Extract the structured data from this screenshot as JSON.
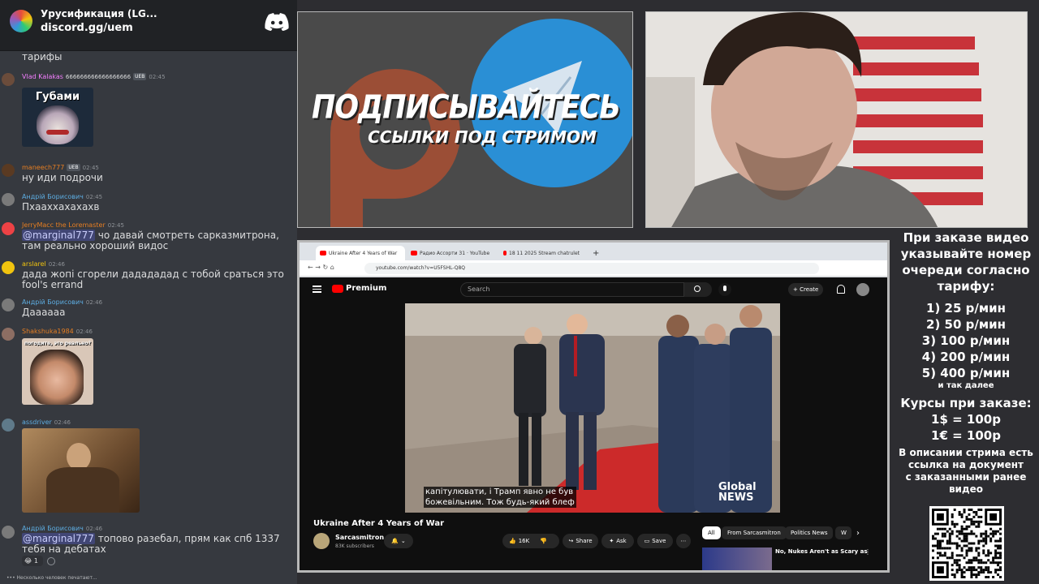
{
  "discord": {
    "server_name": "Урусификация (LG...",
    "invite": "discord.gg/uem",
    "typing": "Несколько человек печатают...",
    "top_partial_text": "тарифы",
    "messages": [
      {
        "user": "Vlad Kalakas",
        "text_inline": "666666666666666666",
        "badge": "UEB",
        "time": "02:45",
        "image_caption": "Губами"
      },
      {
        "user": "maneech777",
        "badge": "UEB",
        "time": "02:45",
        "text": "ну иди подрочи"
      },
      {
        "user": "Андрій Борисович",
        "time": "02:45",
        "text": "Пхааххахахахв"
      },
      {
        "user": "JerryMacc the Loremaster",
        "time": "02:45",
        "mention": "@marginal777",
        "text": "чо давай смотреть сарказмитрона, там реально хороший видос"
      },
      {
        "user": "arslarel",
        "time": "02:46",
        "text": "дада жопі сгорели дадададад с тобой сраться это fool's errand"
      },
      {
        "user": "Андрій Борисович",
        "time": "02:46",
        "text": "Даааааа"
      },
      {
        "user": "Shakshuka1984",
        "time": "02:46",
        "image_caption": "погодите, это реально?"
      },
      {
        "user": "assdriver",
        "time": "02:46"
      },
      {
        "user": "Андрій Борисович",
        "time": "02:46",
        "mention": "@marginal777",
        "text": "топово разебал, прям как спб 1337 тебя на дебатах",
        "reaction": "1"
      }
    ]
  },
  "promo": {
    "title": "ПОДПИСЫВАЙТЕСЬ",
    "subtitle": "ССЫЛКИ ПОД СТРИМОМ"
  },
  "browser": {
    "tabs": [
      "Ukraine After 4 Years of War",
      "Радио Ассорти 31 · YouTube",
      "18 11 2025 Stream chatrulet"
    ],
    "url": "youtube.com/watch?v=U5FSHL-Q8Q"
  },
  "youtube": {
    "logo": "Premium",
    "search_placeholder": "Search",
    "create": "Create",
    "subtitle_line1": "капітулювати, і Трамп явно не був",
    "subtitle_line2": "божевільним.  Тож будь-який блеф",
    "watermark_1": "Global",
    "watermark_2": "NEWS",
    "title": "Ukraine After 4 Years of War",
    "channel": "Sarcasmitron",
    "subscribers": "83K subscribers",
    "likes": "16K",
    "share": "Share",
    "ask": "Ask",
    "save": "Save",
    "chips": [
      "All",
      "From Sarcasmitron",
      "Politics News",
      "W"
    ],
    "rec_title": "No, Nukes Aren't as Scary as"
  },
  "info": {
    "l1": "При заказе видео",
    "l2": "указывайте номер",
    "l3": "очереди согласно",
    "l4": "тарифу:",
    "tiers": [
      "1) 25 р/мин",
      "2) 50 р/мин",
      "3) 100 р/мин",
      "4) 200 р/мин",
      "5) 400 р/мин"
    ],
    "etc": "и так далее",
    "rates_title": "Курсы при заказе:",
    "rate_usd": "1$ = 100р",
    "rate_eur": "1€ = 100р",
    "desc1": "В описании стрима есть",
    "desc2": "ссылка на документ",
    "desc3": "с заказанными ранее",
    "desc4": "видео"
  },
  "colors": {
    "discord_bg": "#36393f",
    "discord_header": "#202225",
    "mention": "#414675",
    "yt_red": "#ff0000",
    "promo_bg": "#4a4a4a"
  }
}
